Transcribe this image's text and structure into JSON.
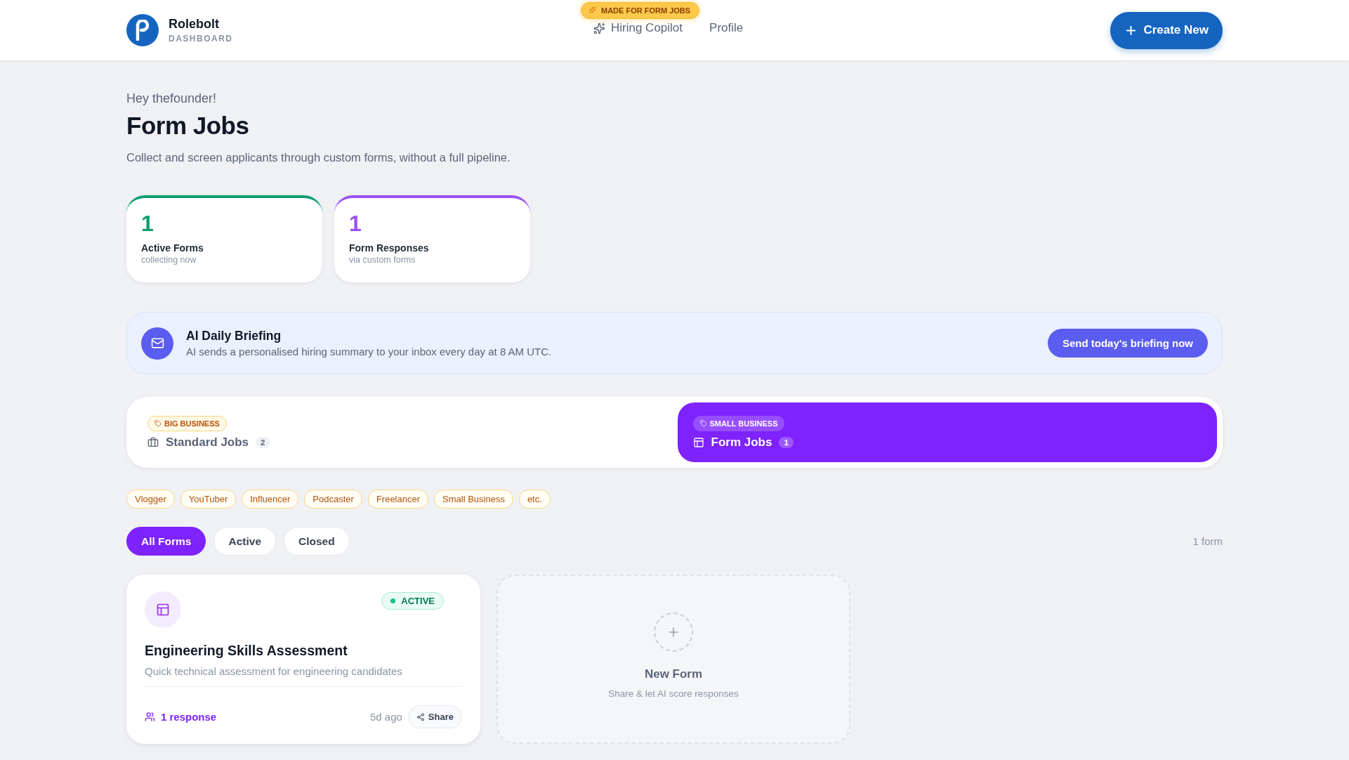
{
  "header": {
    "logo_title": "Rolebolt",
    "logo_subtitle": "DASHBOARD",
    "nav": [
      {
        "label": "Hiring Copilot",
        "badge": "MADE FOR FORM JOBS",
        "kind": "featured"
      },
      {
        "label": "Profile",
        "kind": "plain"
      }
    ],
    "create_button": "Create New"
  },
  "greeting": "Hey thefounder!",
  "title": "Form Jobs",
  "subtitle": "Collect and screen applicants through custom forms, without a full pipeline.",
  "stats": [
    {
      "value": "1",
      "label": "Active Forms",
      "caption": "collecting now",
      "color": "#0e9f6e"
    },
    {
      "value": "1",
      "label": "Form Responses",
      "caption": "via custom forms",
      "color": "#9b51f5"
    }
  ],
  "briefing": {
    "title": "AI Daily Briefing",
    "text": "AI sends a personalised hiring summary to your inbox every day at 8 AM UTC.",
    "button": "Send today's briefing now"
  },
  "job_types": [
    {
      "tag": "BIG BUSINESS",
      "label": "Standard Jobs",
      "count": "2",
      "kind": "standard",
      "selected": false
    },
    {
      "tag": "SMALL BUSINESS",
      "label": "Form Jobs",
      "count": "1",
      "kind": "form",
      "selected": true
    }
  ],
  "audience_tags": [
    "Vlogger",
    "YouTuber",
    "Influencer",
    "Podcaster",
    "Freelancer",
    "Small Business",
    "etc."
  ],
  "filters": [
    {
      "label": "All Forms",
      "selected": true
    },
    {
      "label": "Active",
      "selected": false
    },
    {
      "label": "Closed",
      "selected": false
    }
  ],
  "form_count": "1 form",
  "forms": [
    {
      "title": "Engineering Skills Assessment",
      "description": "Quick technical assessment for engineering candidates",
      "status": "ACTIVE",
      "active": true,
      "responses": "1 response",
      "age": "5d ago",
      "share": "Share"
    }
  ],
  "new_form": {
    "title": "New Form",
    "caption": "Share & let AI score responses"
  }
}
